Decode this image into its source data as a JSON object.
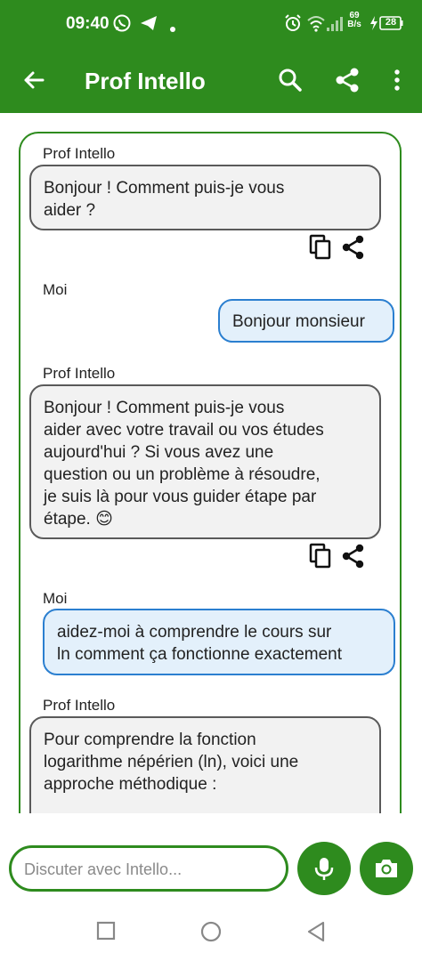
{
  "status_bar": {
    "time": "09:40",
    "speed_top": "69",
    "speed_bottom": "B/s",
    "battery": "28",
    "icons": [
      "whatsapp-icon",
      "telegram-icon",
      "notification-dot-icon",
      "alarm-icon",
      "wifi-icon",
      "signal-icon",
      "battery-charging-icon"
    ]
  },
  "app_bar": {
    "title": "Prof Intello",
    "back_icon": "arrow-left-icon",
    "search_icon": "search-icon",
    "share_icon": "share-icon",
    "menu_icon": "more-vert-icon",
    "background": "#2e8b1e"
  },
  "messages": [
    {
      "sender": "Prof Intello",
      "role": "bot",
      "lines": [
        "Bonjour ! Comment puis-je vous",
        "aider ?"
      ]
    },
    {
      "sender": "Moi",
      "role": "user",
      "lines": [
        "Bonjour monsieur"
      ]
    },
    {
      "sender": "Prof Intello",
      "role": "bot",
      "lines": [
        "Bonjour ! Comment puis-je vous",
        "aider avec votre travail ou vos études",
        "aujourd'hui ? Si vous avez une",
        "question ou un problème à résoudre,",
        "je suis là pour vous guider étape par",
        "étape. 😊"
      ]
    },
    {
      "sender": "Moi",
      "role": "user",
      "lines": [
        "aidez-moi à comprendre le cours sur",
        "ln comment ça fonctionne exactement"
      ]
    },
    {
      "sender": "Prof Intello",
      "role": "bot",
      "lines": [
        "Pour comprendre la fonction",
        "logarithme népérien (ln), voici une",
        "approche méthodique :"
      ]
    }
  ],
  "message_actions": {
    "copy_icon": "copy-icon",
    "share_icon": "share-icon"
  },
  "composer": {
    "placeholder": "Discuter avec Intello...",
    "value": "",
    "mic_icon": "microphone-icon",
    "camera_icon": "camera-icon"
  },
  "nav_bar": {
    "icons": [
      "recents-square-icon",
      "home-circle-icon",
      "back-triangle-icon"
    ]
  },
  "colors": {
    "accent": "#2e8b1e",
    "user_bubble": "#e3f0fb",
    "user_border": "#2b7fd0",
    "bot_bubble": "#f2f2f2",
    "bot_border": "#5a5a5a"
  }
}
